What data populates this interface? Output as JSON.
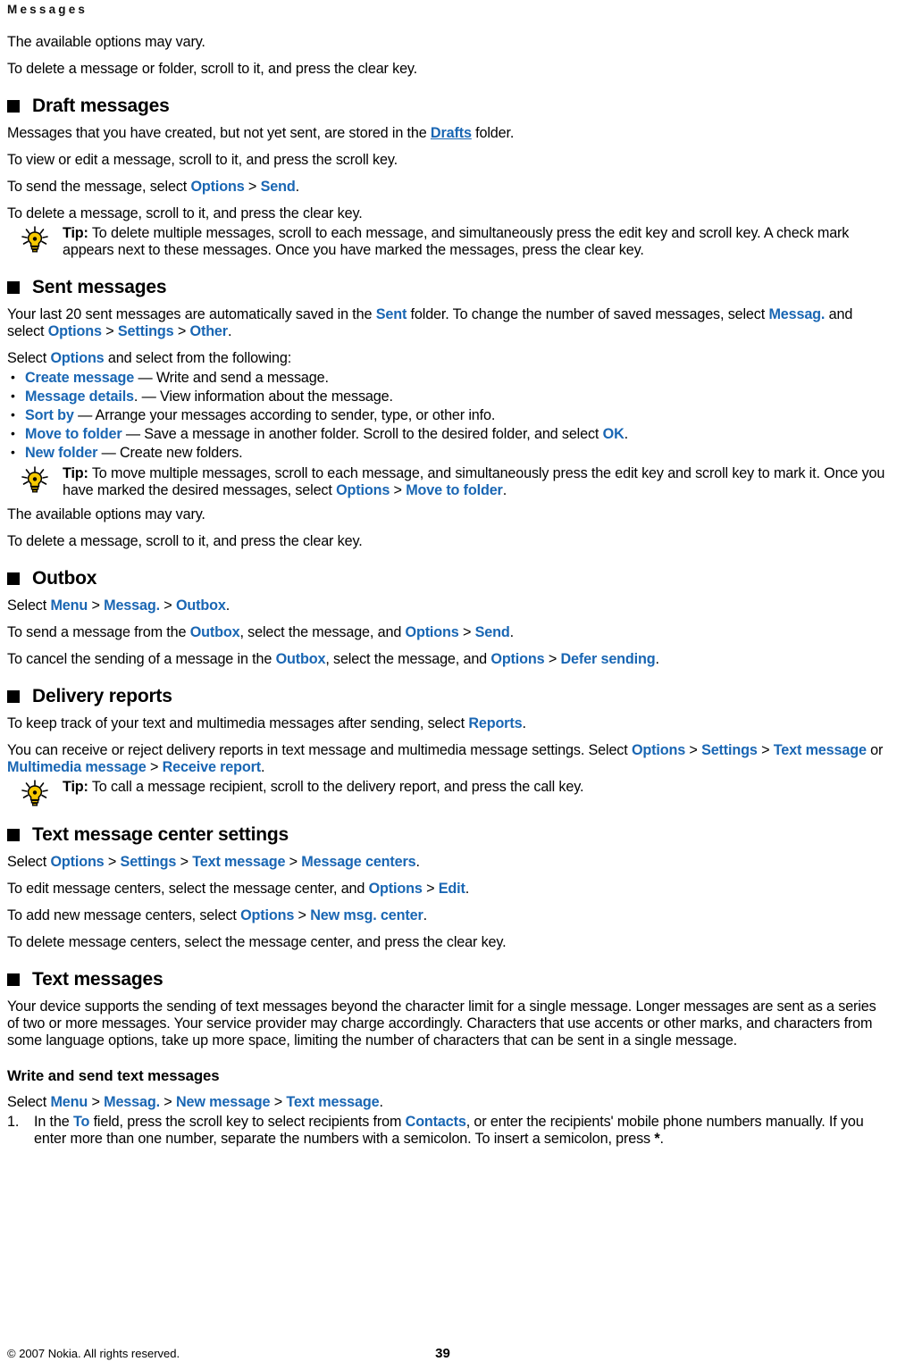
{
  "page": {
    "running_head": "Messages",
    "page_number": "39",
    "copyright": "© 2007 Nokia. All rights reserved.",
    "link_color": "#1966b3",
    "text_color": "#000000",
    "background": "#ffffff"
  },
  "intro": {
    "line1": "The available options may vary.",
    "line2": "To delete a message or folder, scroll to it, and press the clear key."
  },
  "draft_messages": {
    "heading": "Draft messages",
    "p1_a": "Messages that you have created, but not yet sent, are stored in the ",
    "p1_link": "Drafts",
    "p1_b": " folder.",
    "p2": "To view or edit a message, scroll to it, and press the scroll key.",
    "p3_a": "To send the message, select ",
    "p3_link1": "Options",
    "p3_sep": " > ",
    "p3_link2": "Send",
    "p3_b": ".",
    "p4": "To delete a message, scroll to it, and press the clear key.",
    "tip_label": "Tip:",
    "tip_text": " To delete multiple messages, scroll to each message, and simultaneously press the edit key and scroll key. A check mark appears next to these messages. Once you have marked the messages, press the clear key."
  },
  "sent_messages": {
    "heading": "Sent messages",
    "p1_a": "Your last 20 sent messages are automatically saved in the ",
    "p1_link1": "Sent",
    "p1_b": " folder. To change the number of saved messages, select ",
    "p1_link2": "Messag.",
    "p1_c": " and select ",
    "p1_link3": "Options",
    "p1_sep1": " > ",
    "p1_link4": "Settings",
    "p1_sep2": " > ",
    "p1_link5": "Other",
    "p1_d": ".",
    "p2_a": "Select ",
    "p2_link": "Options",
    "p2_b": " and select from the following:",
    "bullets": [
      {
        "link": "Create message",
        "rest": " — Write and send a message."
      },
      {
        "link": "Message details",
        "rest": ". — View information about the message."
      },
      {
        "link": "Sort by",
        "rest": " — Arrange your messages according to sender, type, or other info."
      },
      {
        "link": "Move to folder",
        "rest": " — Save a message in another folder. Scroll to the desired folder, and select ",
        "rest_link": "OK",
        "rest_tail": "."
      },
      {
        "link": "New folder",
        "rest": " — Create new folders."
      }
    ],
    "tip_label": "Tip:",
    "tip_text_a": " To move multiple messages, scroll to each message, and simultaneously press the edit key and scroll key to mark it. Once you have marked the desired messages, select ",
    "tip_link1": "Options",
    "tip_sep": " > ",
    "tip_link2": "Move to folder",
    "tip_text_b": ".",
    "p3": "The available options may vary.",
    "p4": "To delete a message, scroll to it, and press the clear key."
  },
  "outbox": {
    "heading": "Outbox",
    "p1_a": "Select ",
    "p1_link1": "Menu",
    "p1_sep1": " > ",
    "p1_link2": "Messag.",
    "p1_sep2": " > ",
    "p1_link3": "Outbox",
    "p1_b": ".",
    "p2_a": "To send a message from the ",
    "p2_link1": "Outbox",
    "p2_b": ", select the message, and ",
    "p2_link2": "Options",
    "p2_sep": " > ",
    "p2_link3": "Send",
    "p2_c": ".",
    "p3_a": "To cancel the sending of a message in the ",
    "p3_link1": "Outbox",
    "p3_b": ", select the message, and ",
    "p3_link2": "Options",
    "p3_sep": " > ",
    "p3_link3": "Defer sending",
    "p3_c": "."
  },
  "delivery_reports": {
    "heading": "Delivery reports",
    "p1_a": "To keep track of your text and multimedia messages after sending, select ",
    "p1_link": "Reports",
    "p1_b": ".",
    "p2_a": "You can receive or reject delivery reports in text message and multimedia message settings. Select ",
    "p2_link1": "Options",
    "p2_sep1": " > ",
    "p2_link2": "Settings",
    "p2_sep2": " > ",
    "p2_link3": "Text message",
    "p2_b": " or ",
    "p2_link4": "Multimedia message",
    "p2_sep3": " > ",
    "p2_link5": "Receive report",
    "p2_c": ".",
    "tip_label": "Tip:",
    "tip_text": " To call a message recipient, scroll to the delivery report, and press the call key."
  },
  "text_message_center_settings": {
    "heading": "Text message center settings",
    "p1_a": "Select ",
    "p1_link1": "Options",
    "p1_sep1": " > ",
    "p1_link2": "Settings",
    "p1_sep2": " > ",
    "p1_link3": "Text message",
    "p1_sep3": " > ",
    "p1_link4": "Message centers",
    "p1_b": ".",
    "p2_a": "To edit message centers, select the message center, and ",
    "p2_link1": "Options",
    "p2_sep": " > ",
    "p2_link2": "Edit",
    "p2_b": ".",
    "p3_a": "To add new message centers, select ",
    "p3_link1": "Options",
    "p3_sep": " > ",
    "p3_link2": "New msg. center",
    "p3_b": ".",
    "p4": "To delete message centers, select the message center, and press the clear key."
  },
  "text_messages": {
    "heading": "Text messages",
    "p1": "Your device supports the sending of text messages beyond the character limit for a single message. Longer messages are sent as a series of two or more messages. Your service provider may charge accordingly. Characters that use accents or other marks, and characters from some language options, take up more space, limiting the number of characters that can be sent in a single message.",
    "sub_heading": "Write and send text messages",
    "p2_a": "Select ",
    "p2_link1": "Menu",
    "p2_sep1": " > ",
    "p2_link2": "Messag.",
    "p2_sep2": " > ",
    "p2_link3": "New message",
    "p2_sep3": " > ",
    "p2_link4": "Text message",
    "p2_b": ".",
    "step1_a": "In the ",
    "step1_link1": "To",
    "step1_b": " field, press the scroll key to select recipients from ",
    "step1_link2": "Contacts",
    "step1_c": ", or enter the recipients' mobile phone numbers manually. If you enter more than one number, separate the numbers with a semicolon. To insert a semicolon, press ",
    "step1_bold": "*",
    "step1_d": "."
  },
  "icons": {
    "tip_icon": "lightbulb-icon",
    "section_marker": "black-square-marker"
  }
}
